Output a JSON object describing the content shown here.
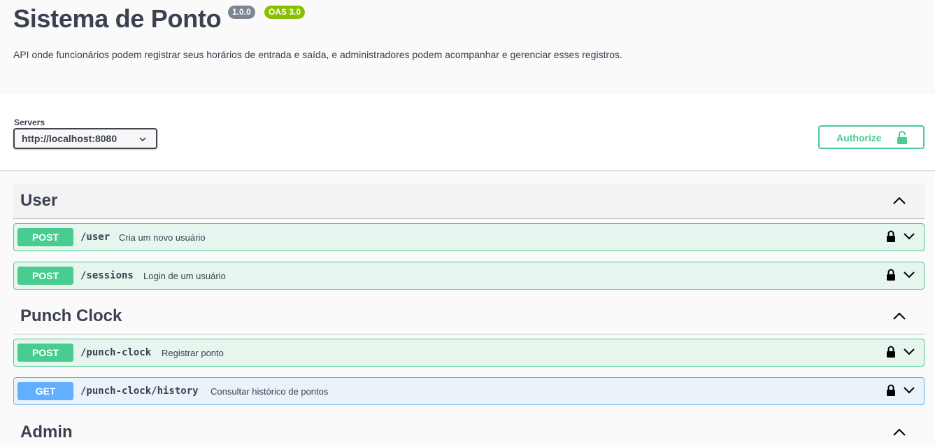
{
  "info": {
    "title": "Sistema de Ponto",
    "version": "1.0.0",
    "oas": "OAS 3.0",
    "description": "API onde funcionários podem registrar seus horários de entrada e saída, e administradores podem acompanhar e gerenciar esses registros."
  },
  "servers": {
    "label": "Servers",
    "selected": "http://localhost:8080"
  },
  "authorize": {
    "label": "Authorize"
  },
  "tags": [
    {
      "name": "User",
      "operations": [
        {
          "method": "POST",
          "path": "/user",
          "summary": "Cria um novo usuário"
        },
        {
          "method": "POST",
          "path": "/sessions",
          "summary": "Login de um usuário"
        }
      ]
    },
    {
      "name": "Punch Clock",
      "operations": [
        {
          "method": "POST",
          "path": "/punch-clock",
          "summary": "Registrar ponto"
        },
        {
          "method": "GET",
          "path": "/punch-clock/history",
          "summary": "Consultar histórico de pontos"
        }
      ]
    },
    {
      "name": "Admin",
      "operations": []
    }
  ],
  "colors": {
    "post": "#49cc90",
    "get": "#61affe",
    "version_badge": "#7d8492",
    "oas_badge": "#89bf04"
  }
}
